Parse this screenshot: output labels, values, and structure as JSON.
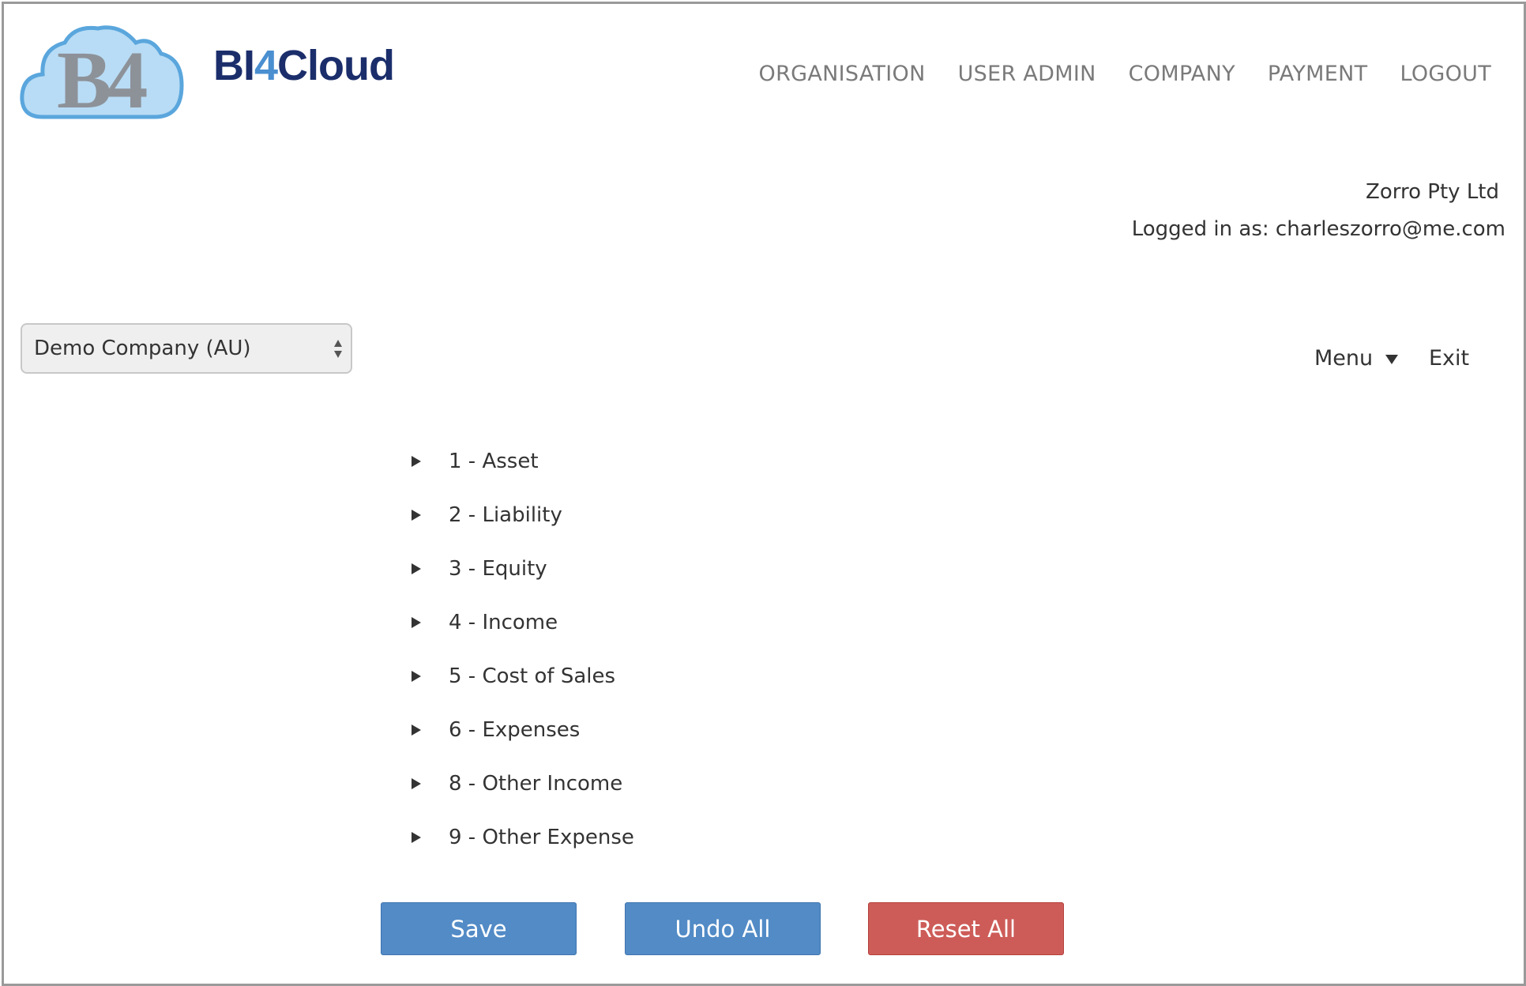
{
  "header": {
    "logo": {
      "icon": "b4-cloud-logo",
      "text": "B4"
    },
    "brand": {
      "part1": "BI",
      "part2": "4",
      "part3": "Cloud"
    },
    "nav": [
      "ORGANISATION",
      "USER ADMIN",
      "COMPANY",
      "PAYMENT",
      "LOGOUT"
    ]
  },
  "user": {
    "company": "Zorro Pty Ltd",
    "logged_in": "Logged in as: charleszorro@me.com"
  },
  "company_select": {
    "value": "Demo Company (AU)",
    "icon": "select-arrows-icon"
  },
  "actions": {
    "menu_label": "Menu",
    "menu_icon": "caret-down-icon",
    "exit_label": "Exit"
  },
  "accounts": [
    "1 - Asset",
    "2 - Liability",
    "3 - Equity",
    "4 - Income",
    "5 - Cost of Sales",
    "6 - Expenses",
    "8 - Other Income",
    "9 - Other Expense"
  ],
  "buttons": {
    "save": "Save",
    "undo_all": "Undo All",
    "reset_all": "Reset All"
  },
  "colors": {
    "primary_button": "#528bc6",
    "danger_button": "#cd5c58",
    "brand_dark": "#1b2e6b",
    "brand_accent": "#4a8fd0",
    "nav_text": "#7a7a7a"
  }
}
